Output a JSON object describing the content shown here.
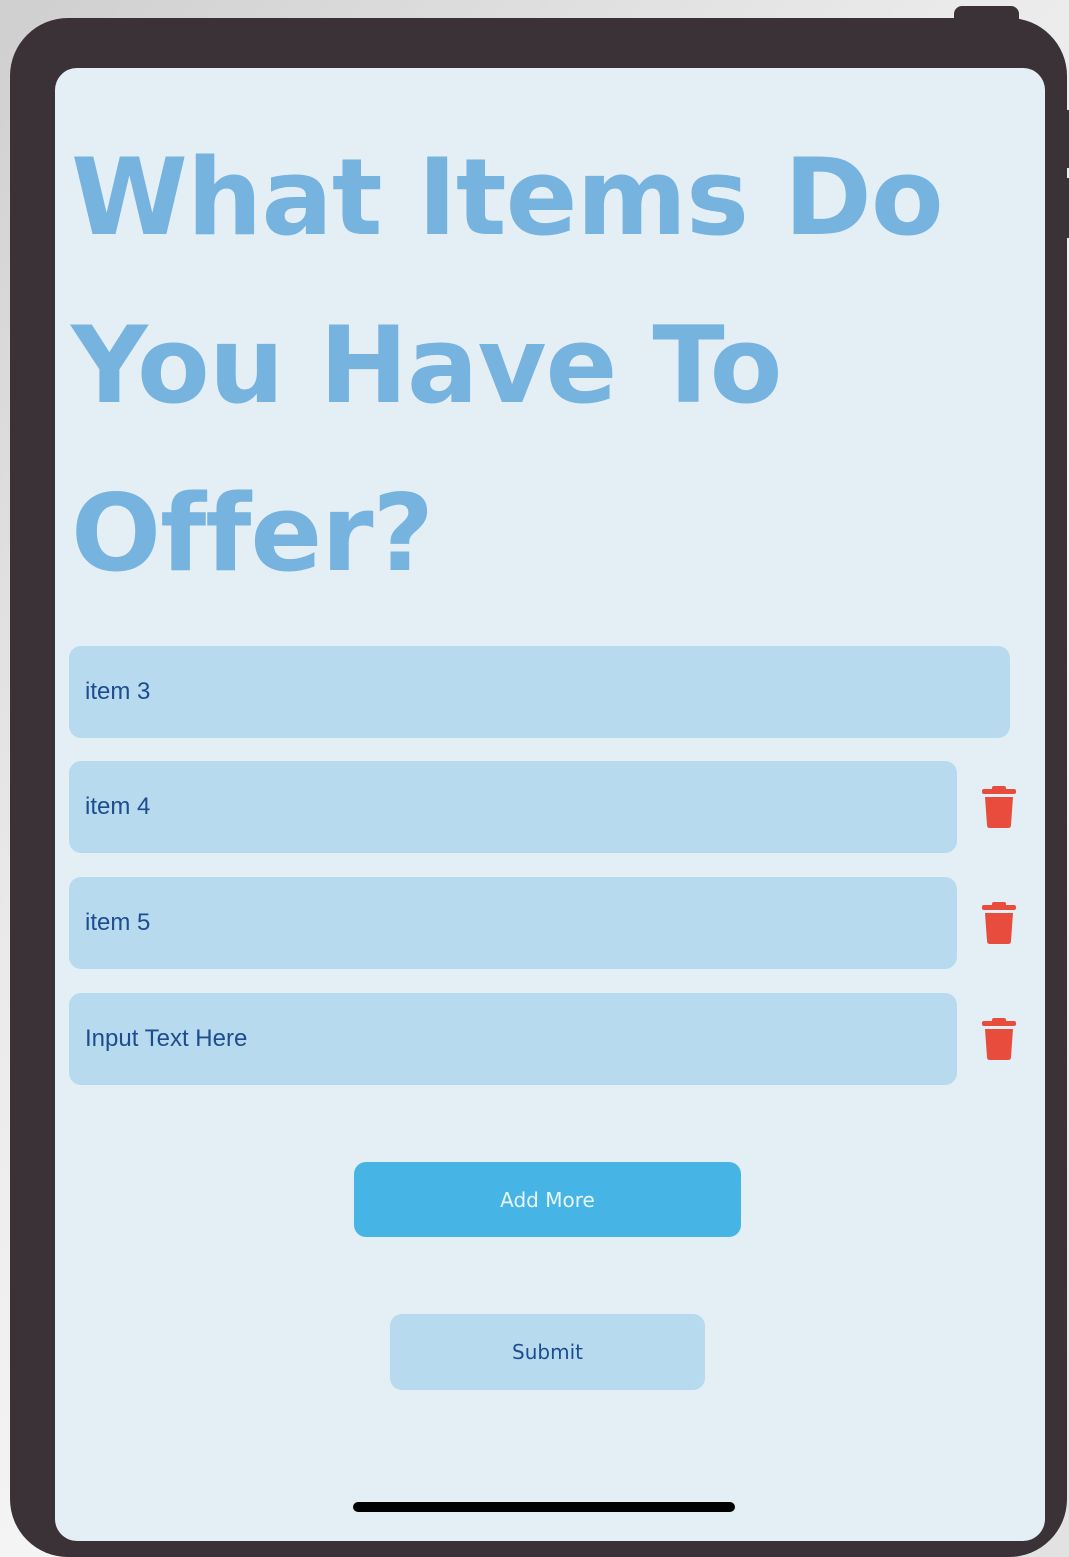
{
  "page": {
    "title": "What Items Do You Have To Offer?"
  },
  "items": [
    {
      "value": "item 3",
      "deletable": false
    },
    {
      "value": "item 4",
      "deletable": true
    },
    {
      "value": "item 5",
      "deletable": true
    },
    {
      "value": "Input Text Here",
      "deletable": true
    }
  ],
  "actions": {
    "add_more_label": "Add More",
    "submit_label": "Submit"
  },
  "icons": {
    "delete": "trash-icon"
  },
  "colors": {
    "title": "#77b3df",
    "field_background": "#b8daee",
    "field_text": "#1d4d8f",
    "add_button": "#46b5e5",
    "delete_icon": "#e84c3d",
    "screen_background": "#e4eff5",
    "device_frame": "#3a3236"
  }
}
